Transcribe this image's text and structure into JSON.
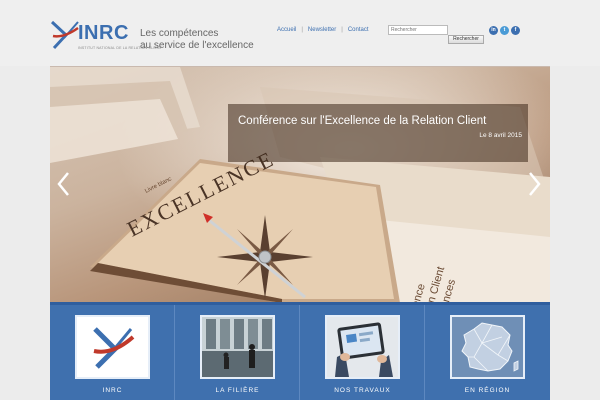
{
  "header": {
    "logo_text": "INRC",
    "logo_subtitle": "INSTITUT NATIONAL DE LA RELATION CLIENT",
    "tagline_line1": "Les compétences",
    "tagline_line2": "au service de l'excellence",
    "nav": [
      "Accueil",
      "Newsletter",
      "Contact"
    ],
    "search": {
      "placeholder": "Rechercher",
      "button_label": "Rechercher"
    },
    "social": [
      {
        "icon": "linkedin-icon",
        "glyph": "in"
      },
      {
        "icon": "twitter-icon",
        "glyph": "t"
      },
      {
        "icon": "facebook-icon",
        "glyph": "f"
      }
    ]
  },
  "hero": {
    "title": "Conférence sur l'Excellence de la Relation Client",
    "date": "Le 8 avril 2015",
    "book_cover_word": "EXCELLENCE",
    "book_spine_word": "Livre blanc",
    "page_text_lines": [
      "L'Excellence",
      "la Relation Client",
      "s compétences"
    ],
    "prev_icon": "chevron-left-icon",
    "next_icon": "chevron-right-icon"
  },
  "tiles": [
    {
      "label": "INRC",
      "image": "inrc-logo"
    },
    {
      "label": "LA FILIÈRE",
      "image": "office-lobby-photo"
    },
    {
      "label": "NOS TRAVAUX",
      "image": "tablet-photo"
    },
    {
      "label": "EN RÉGION",
      "image": "france-map"
    }
  ],
  "colors": {
    "brand_blue": "#3c6fb0",
    "tile_bar": "#3f70ae",
    "logo_red": "#c0392b",
    "background": "#efefef"
  }
}
